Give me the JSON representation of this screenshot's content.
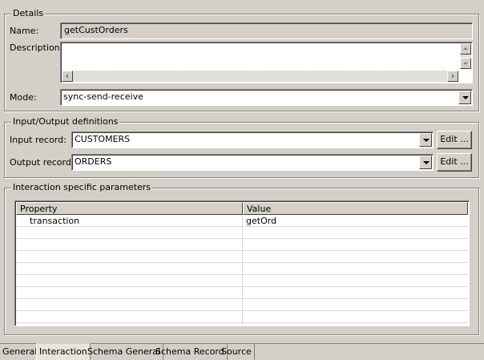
{
  "details": {
    "group_title": "Details",
    "name_label": "Name:",
    "name_value": "getCustOrders",
    "description_label": "Description:",
    "description_value": "",
    "mode_label": "Mode:",
    "mode_value": "sync-send-receive"
  },
  "io": {
    "group_title": "Input/Output definitions",
    "input_label": "Input record:",
    "input_value": "CUSTOMERS",
    "output_label": "Output record:",
    "output_value": "ORDERS",
    "edit_label": "Edit ..."
  },
  "params": {
    "group_title": "Interaction specific parameters",
    "columns": [
      "Property",
      "Value"
    ],
    "rows": [
      {
        "property": "transaction",
        "value": "getOrd"
      }
    ]
  },
  "tabs": [
    {
      "label": "General",
      "active": false
    },
    {
      "label": "Interaction",
      "active": true
    },
    {
      "label": "Schema General",
      "active": false
    },
    {
      "label": "Schema Record",
      "active": false
    },
    {
      "label": "Source",
      "active": false
    }
  ]
}
